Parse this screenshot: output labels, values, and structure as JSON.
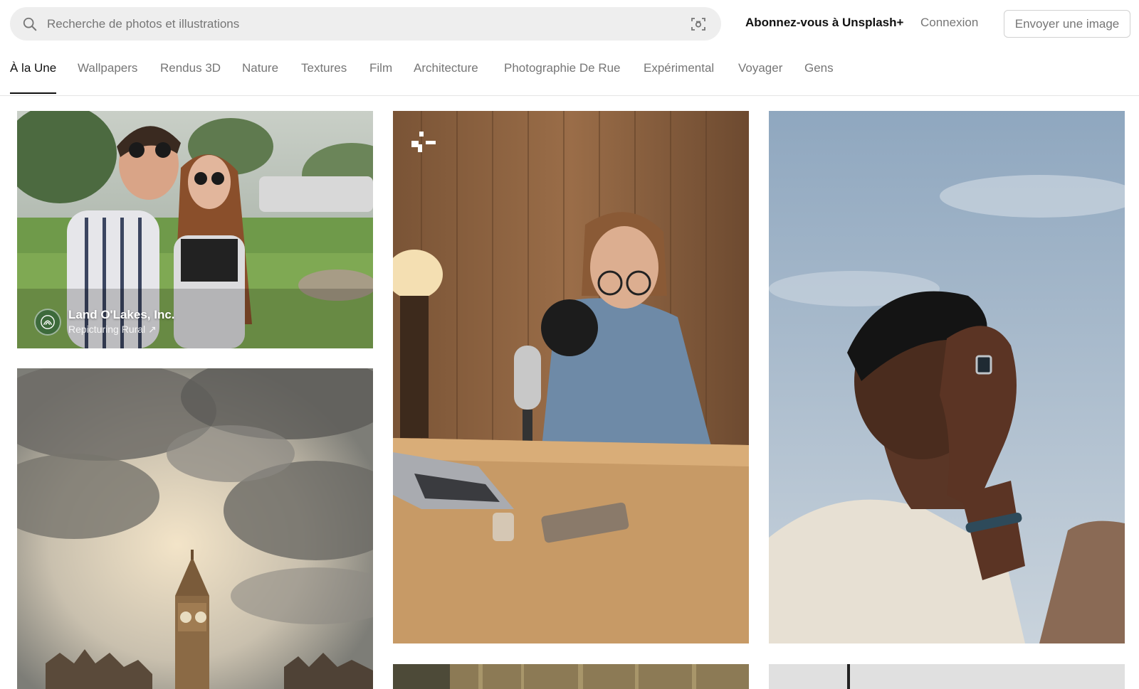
{
  "search": {
    "placeholder": "Recherche de photos et illustrations"
  },
  "header": {
    "plus_link": "Abonnez-vous à Unsplash+",
    "login_link": "Connexion",
    "submit_button": "Envoyer une image"
  },
  "tabs": [
    {
      "label": "À la Une",
      "active": true
    },
    {
      "label": "Wallpapers"
    },
    {
      "label": "Rendus 3D"
    },
    {
      "label": "Nature"
    },
    {
      "label": "Textures"
    },
    {
      "label": "Film"
    },
    {
      "label": "Architecture"
    },
    {
      "label": "Photographie De Rue"
    },
    {
      "label": "Expérimental"
    },
    {
      "label": "Voyager"
    },
    {
      "label": "Gens"
    }
  ],
  "photos": {
    "couple": {
      "author_name": "Land O'Lakes, Inc.",
      "author_sub": "Repicturing Rural ↗"
    }
  },
  "icons": {
    "search": "search-icon",
    "visual_search": "visual-search-icon",
    "plus_badge": "unsplash-plus-icon",
    "external": "arrow-up-right-icon"
  },
  "colors": {
    "text_primary": "#111111",
    "text_secondary": "#767676",
    "search_bg": "#eeeeee",
    "border": "#d1d1d1"
  }
}
